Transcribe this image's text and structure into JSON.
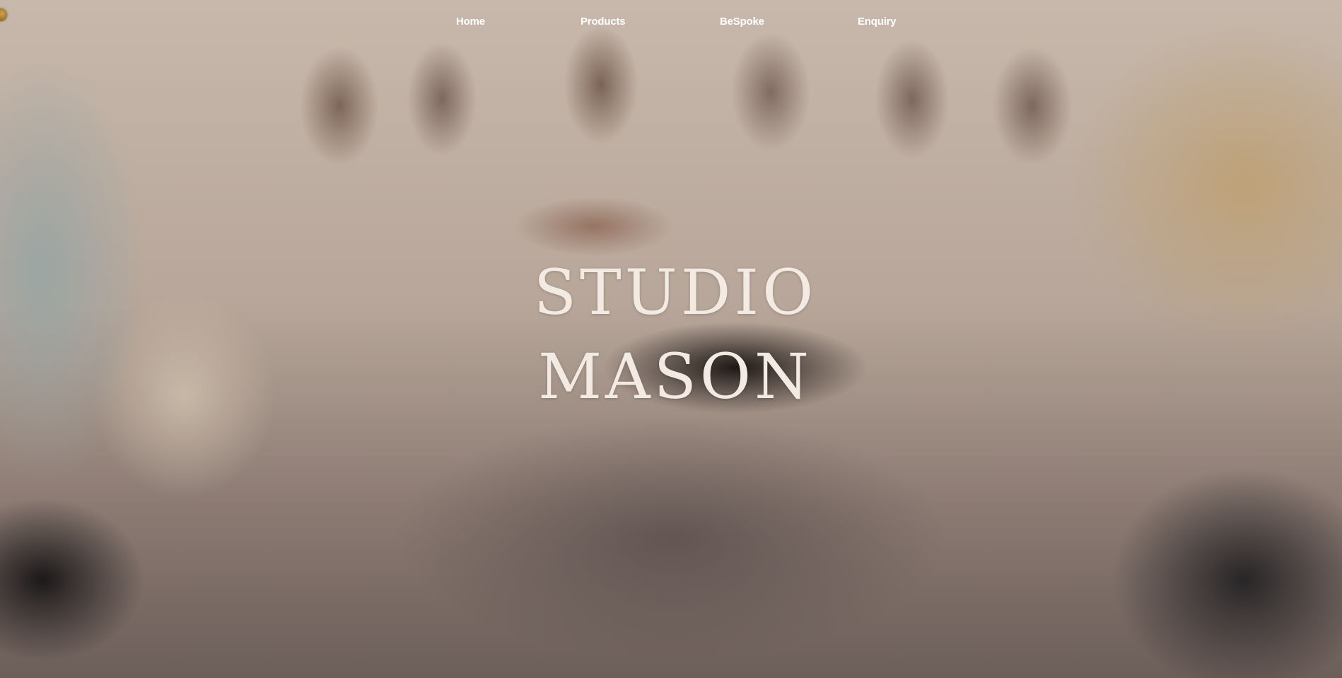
{
  "nav": {
    "items": [
      {
        "label": "Home"
      },
      {
        "label": "Products"
      },
      {
        "label": "BeSpoke"
      },
      {
        "label": "Enquiry"
      }
    ]
  },
  "hero": {
    "title_line1": "STUDIO",
    "title_line2": "MASON"
  },
  "icons": {
    "corner": "logo-icon"
  },
  "colors": {
    "nav_text": "#ffffff",
    "title_text": "#f3ebe3",
    "logo": "#b8892f"
  }
}
